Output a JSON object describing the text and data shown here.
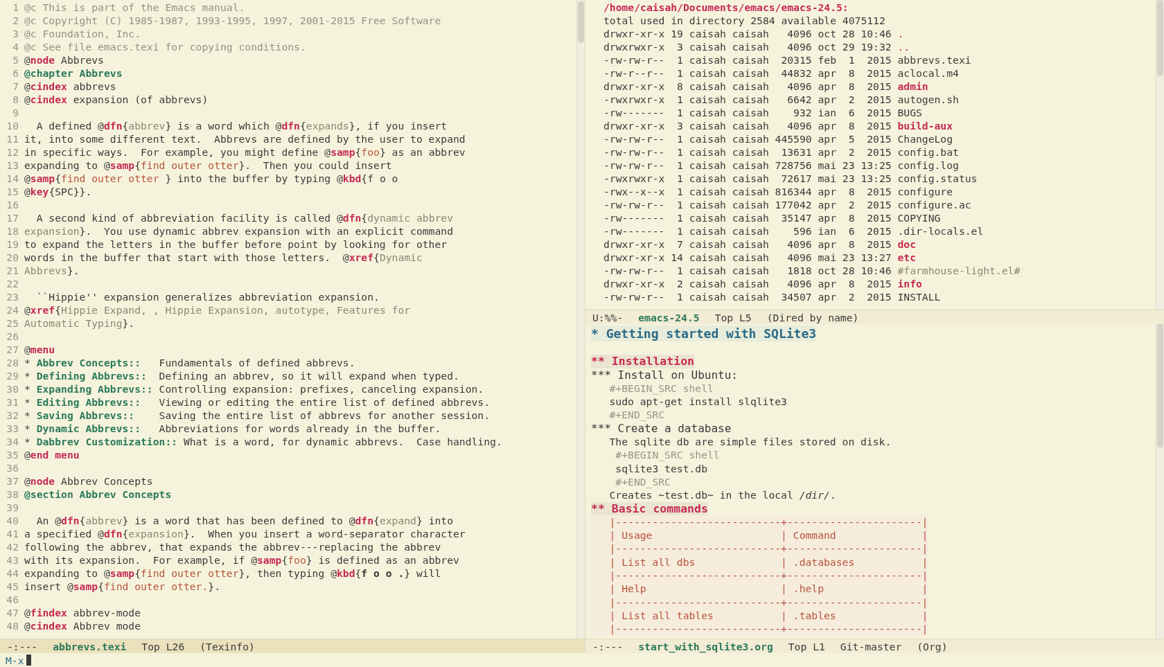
{
  "texinfo_window": {
    "lines": [
      {
        "num": "1",
        "segs": [
          {
            "kind": "c",
            "text": "@c This is part of the Emacs manual."
          }
        ]
      },
      {
        "num": "2",
        "segs": [
          {
            "kind": "c",
            "text": "@c Copyright (C) 1985-1987, 1993-1995, 1997, 2001-2015 Free Software"
          }
        ]
      },
      {
        "num": "3",
        "segs": [
          {
            "kind": "c",
            "text": "@c Foundation, Inc."
          }
        ]
      },
      {
        "num": "4",
        "segs": [
          {
            "kind": "c",
            "text": "@c See file emacs.texi for copying conditions."
          }
        ]
      },
      {
        "num": "5",
        "segs": [
          {
            "kind": "p",
            "text": "@"
          },
          {
            "kind": "k",
            "text": "node"
          },
          {
            "kind": "p",
            "text": " Abbrevs"
          }
        ]
      },
      {
        "num": "6",
        "segs": [
          {
            "kind": "h",
            "text": "@chapter Abbrevs"
          }
        ]
      },
      {
        "num": "7",
        "segs": [
          {
            "kind": "p",
            "text": "@"
          },
          {
            "kind": "k",
            "text": "cindex"
          },
          {
            "kind": "p",
            "text": " abbrevs"
          }
        ]
      },
      {
        "num": "8",
        "segs": [
          {
            "kind": "p",
            "text": "@"
          },
          {
            "kind": "k",
            "text": "cindex"
          },
          {
            "kind": "p",
            "text": " expansion (of abbrevs)"
          }
        ]
      },
      {
        "num": "9"
      },
      {
        "num": "10",
        "segs": [
          {
            "kind": "p",
            "text": "  A defined @"
          },
          {
            "kind": "k",
            "text": "dfn"
          },
          {
            "kind": "p",
            "text": "{"
          },
          {
            "kind": "a",
            "text": "abbrev"
          },
          {
            "kind": "p",
            "text": "} is a word which @"
          },
          {
            "kind": "k",
            "text": "dfn"
          },
          {
            "kind": "p",
            "text": "{"
          },
          {
            "kind": "a",
            "text": "expands"
          },
          {
            "kind": "p",
            "text": "}, if you insert"
          }
        ]
      },
      {
        "num": "11",
        "segs": [
          {
            "kind": "p",
            "text": "it, into some different text.  Abbrevs are defined by the user to expand"
          }
        ]
      },
      {
        "num": "12",
        "segs": [
          {
            "kind": "p",
            "text": "in specific ways.  For example, you might define @"
          },
          {
            "kind": "k",
            "text": "samp"
          },
          {
            "kind": "p",
            "text": "{"
          },
          {
            "kind": "s",
            "text": "foo"
          },
          {
            "kind": "p",
            "text": "} as an abbrev"
          }
        ]
      },
      {
        "num": "13",
        "segs": [
          {
            "kind": "p",
            "text": "expanding to @"
          },
          {
            "kind": "k",
            "text": "samp"
          },
          {
            "kind": "p",
            "text": "{"
          },
          {
            "kind": "s",
            "text": "find outer otter"
          },
          {
            "kind": "p",
            "text": "}.  Then you could insert"
          }
        ]
      },
      {
        "num": "14",
        "segs": [
          {
            "kind": "p",
            "text": "@"
          },
          {
            "kind": "k",
            "text": "samp"
          },
          {
            "kind": "p",
            "text": "{"
          },
          {
            "kind": "s",
            "text": "find outer otter "
          },
          {
            "kind": "p",
            "text": "} into the buffer by typing @"
          },
          {
            "kind": "k",
            "text": "kbd"
          },
          {
            "kind": "p",
            "text": "{f o o"
          }
        ]
      },
      {
        "num": "15",
        "segs": [
          {
            "kind": "p",
            "text": "@"
          },
          {
            "kind": "k",
            "text": "key"
          },
          {
            "kind": "p",
            "text": "{SPC}}."
          }
        ]
      },
      {
        "num": "16"
      },
      {
        "num": "17",
        "segs": [
          {
            "kind": "p",
            "text": "  A second kind of abbreviation facility is called @"
          },
          {
            "kind": "k",
            "text": "dfn"
          },
          {
            "kind": "p",
            "text": "{"
          },
          {
            "kind": "a",
            "text": "dynamic abbrev"
          }
        ]
      },
      {
        "num": "18",
        "segs": [
          {
            "kind": "a",
            "text": "expansion"
          },
          {
            "kind": "p",
            "text": "}.  You use dynamic abbrev expansion with an explicit command"
          }
        ]
      },
      {
        "num": "19",
        "segs": [
          {
            "kind": "p",
            "text": "to expand the letters in the buffer before point by looking for other"
          }
        ]
      },
      {
        "num": "20",
        "segs": [
          {
            "kind": "p",
            "text": "words in the buffer that start with those letters.  @"
          },
          {
            "kind": "k",
            "text": "xref"
          },
          {
            "kind": "p",
            "text": "{"
          },
          {
            "kind": "a",
            "text": "Dynamic"
          }
        ]
      },
      {
        "num": "21",
        "segs": [
          {
            "kind": "a",
            "text": "Abbrevs"
          },
          {
            "kind": "p",
            "text": "}."
          }
        ]
      },
      {
        "num": "22"
      },
      {
        "num": "23",
        "segs": [
          {
            "kind": "p",
            "text": "  ``Hippie'' expansion generalizes abbreviation expansion."
          }
        ]
      },
      {
        "num": "24",
        "segs": [
          {
            "kind": "p",
            "text": "@"
          },
          {
            "kind": "k",
            "text": "xref"
          },
          {
            "kind": "p",
            "text": "{"
          },
          {
            "kind": "a",
            "text": "Hippie Expand, , Hippie Expansion, autotype, Features for"
          }
        ]
      },
      {
        "num": "25",
        "segs": [
          {
            "kind": "a",
            "text": "Automatic Typing"
          },
          {
            "kind": "p",
            "text": "}."
          }
        ]
      },
      {
        "num": "26"
      },
      {
        "num": "27",
        "segs": [
          {
            "kind": "p",
            "text": "@"
          },
          {
            "kind": "k",
            "text": "menu"
          }
        ]
      },
      {
        "num": "28",
        "segs": [
          {
            "kind": "p",
            "text": "* "
          },
          {
            "kind": "h",
            "text": "Abbrev Concepts::"
          },
          {
            "kind": "p",
            "text": "   Fundamentals of defined abbrevs."
          }
        ]
      },
      {
        "num": "29",
        "segs": [
          {
            "kind": "p",
            "text": "* "
          },
          {
            "kind": "h",
            "text": "Defining Abbrevs::"
          },
          {
            "kind": "p",
            "text": "  Defining an abbrev, so it will expand when typed."
          }
        ]
      },
      {
        "num": "30",
        "segs": [
          {
            "kind": "p",
            "text": "* "
          },
          {
            "kind": "h",
            "text": "Expanding Abbrevs::"
          },
          {
            "kind": "p",
            "text": " Controlling expansion: prefixes, canceling expansion."
          }
        ]
      },
      {
        "num": "31",
        "segs": [
          {
            "kind": "p",
            "text": "* "
          },
          {
            "kind": "h",
            "text": "Editing Abbrevs::"
          },
          {
            "kind": "p",
            "text": "   Viewing or editing the entire list of defined abbrevs."
          }
        ]
      },
      {
        "num": "32",
        "segs": [
          {
            "kind": "p",
            "text": "* "
          },
          {
            "kind": "h",
            "text": "Saving Abbrevs::"
          },
          {
            "kind": "p",
            "text": "    Saving the entire list of abbrevs for another session."
          }
        ]
      },
      {
        "num": "33",
        "segs": [
          {
            "kind": "p",
            "text": "* "
          },
          {
            "kind": "h",
            "text": "Dynamic Abbrevs::"
          },
          {
            "kind": "p",
            "text": "   Abbreviations for words already in the buffer."
          }
        ]
      },
      {
        "num": "34",
        "segs": [
          {
            "kind": "p",
            "text": "* "
          },
          {
            "kind": "h",
            "text": "Dabbrev Customization::"
          },
          {
            "kind": "p",
            "text": " What is a word, for dynamic abbrevs.  Case handling."
          }
        ]
      },
      {
        "num": "35",
        "segs": [
          {
            "kind": "p",
            "text": "@"
          },
          {
            "kind": "k",
            "text": "end menu"
          }
        ]
      },
      {
        "num": "36"
      },
      {
        "num": "37",
        "segs": [
          {
            "kind": "p",
            "text": "@"
          },
          {
            "kind": "k",
            "text": "node"
          },
          {
            "kind": "p",
            "text": " Abbrev Concepts"
          }
        ]
      },
      {
        "num": "38",
        "segs": [
          {
            "kind": "h",
            "text": "@section Abbrev Concepts"
          }
        ]
      },
      {
        "num": "39"
      },
      {
        "num": "40",
        "segs": [
          {
            "kind": "p",
            "text": "  An @"
          },
          {
            "kind": "k",
            "text": "dfn"
          },
          {
            "kind": "p",
            "text": "{"
          },
          {
            "kind": "a",
            "text": "abbrev"
          },
          {
            "kind": "p",
            "text": "} is a word that has been defined to @"
          },
          {
            "kind": "k",
            "text": "dfn"
          },
          {
            "kind": "p",
            "text": "{"
          },
          {
            "kind": "a",
            "text": "expand"
          },
          {
            "kind": "p",
            "text": "} into"
          }
        ]
      },
      {
        "num": "41",
        "segs": [
          {
            "kind": "p",
            "text": "a specified @"
          },
          {
            "kind": "k",
            "text": "dfn"
          },
          {
            "kind": "p",
            "text": "{"
          },
          {
            "kind": "a",
            "text": "expansion"
          },
          {
            "kind": "p",
            "text": "}.  When you insert a word-separator character"
          }
        ]
      },
      {
        "num": "42",
        "segs": [
          {
            "kind": "p",
            "text": "following the abbrev, that expands the abbrev---replacing the abbrev"
          }
        ]
      },
      {
        "num": "43",
        "segs": [
          {
            "kind": "p",
            "text": "with its expansion.  For example, if @"
          },
          {
            "kind": "k",
            "text": "samp"
          },
          {
            "kind": "p",
            "text": "{"
          },
          {
            "kind": "s",
            "text": "foo"
          },
          {
            "kind": "p",
            "text": "} is defined as an abbrev"
          }
        ]
      },
      {
        "num": "44",
        "segs": [
          {
            "kind": "p",
            "text": "expanding to @"
          },
          {
            "kind": "k",
            "text": "samp"
          },
          {
            "kind": "p",
            "text": "{"
          },
          {
            "kind": "s",
            "text": "find outer otter"
          },
          {
            "kind": "p",
            "text": "}, then typing @"
          },
          {
            "kind": "k",
            "text": "kbd"
          },
          {
            "kind": "p",
            "text": "{"
          },
          {
            "kind": "b",
            "text": "f o o ."
          },
          {
            "kind": "p",
            "text": "} will"
          }
        ]
      },
      {
        "num": "45",
        "segs": [
          {
            "kind": "p",
            "text": "insert @"
          },
          {
            "kind": "k",
            "text": "samp"
          },
          {
            "kind": "p",
            "text": "{"
          },
          {
            "kind": "s",
            "text": "find outer otter."
          },
          {
            "kind": "p",
            "text": "}."
          }
        ]
      },
      {
        "num": "46"
      },
      {
        "num": "47",
        "segs": [
          {
            "kind": "p",
            "text": "@"
          },
          {
            "kind": "k",
            "text": "findex"
          },
          {
            "kind": "p",
            "text": " abbrev-mode"
          }
        ]
      },
      {
        "num": "48",
        "segs": [
          {
            "kind": "p",
            "text": "@"
          },
          {
            "kind": "k",
            "text": "cindex"
          },
          {
            "kind": "p",
            "text": " Abbrev mode"
          }
        ]
      }
    ],
    "mode_line": {
      "active": true,
      "state": "-:---",
      "buffer": "abbrevs.texi",
      "position": "Top L26",
      "mode": "(Texinfo)"
    }
  },
  "dired_window": {
    "header": "/home/caisah/Documents/emacs/emacs-24.5:",
    "total": "total used in directory 2584 available 4075112",
    "rows": [
      {
        "info": "drwxr-xr-x 19 caisah caisah   4096 oct 28 10:46",
        "name": ".",
        "kind": "dot"
      },
      {
        "info": "drwxrwxr-x  3 caisah caisah   4096 oct 29 19:32",
        "name": "..",
        "kind": "dot"
      },
      {
        "info": "-rw-rw-r--  1 caisah caisah  20315 feb  1  2015",
        "name": "abbrevs.texi",
        "kind": "file"
      },
      {
        "info": "-rw-r--r--  1 caisah caisah  44832 apr  8  2015",
        "name": "aclocal.m4",
        "kind": "file"
      },
      {
        "info": "drwxr-xr-x  8 caisah caisah   4096 apr  8  2015",
        "name": "admin",
        "kind": "dir"
      },
      {
        "info": "-rwxrwxr-x  1 caisah caisah   6642 apr  2  2015",
        "name": "autogen.sh",
        "kind": "file"
      },
      {
        "info": "-rw-------  1 caisah caisah    932 ian  6  2015",
        "name": "BUGS",
        "kind": "file"
      },
      {
        "info": "drwxr-xr-x  3 caisah caisah   4096 apr  8  2015",
        "name": "build-aux",
        "kind": "dir"
      },
      {
        "info": "-rw-rw-r--  1 caisah caisah 445590 apr  5  2015",
        "name": "ChangeLog",
        "kind": "file"
      },
      {
        "info": "-rw-rw-r--  1 caisah caisah  13631 apr  2  2015",
        "name": "config.bat",
        "kind": "file"
      },
      {
        "info": "-rw-rw-r--  1 caisah caisah 728756 mai 23 13:25",
        "name": "config.log",
        "kind": "file"
      },
      {
        "info": "-rwxrwxr-x  1 caisah caisah  72617 mai 23 13:25",
        "name": "config.status",
        "kind": "file"
      },
      {
        "info": "-rwx--x--x  1 caisah caisah 816344 apr  8  2015",
        "name": "configure",
        "kind": "file"
      },
      {
        "info": "-rw-rw-r--  1 caisah caisah 177042 apr  2  2015",
        "name": "configure.ac",
        "kind": "file"
      },
      {
        "info": "-rw-------  1 caisah caisah  35147 apr  8  2015",
        "name": "COPYING",
        "kind": "file"
      },
      {
        "info": "-rw-------  1 caisah caisah    596 ian  6  2015",
        "name": ".dir-locals.el",
        "kind": "file"
      },
      {
        "info": "drwxr-xr-x  7 caisah caisah   4096 apr  8  2015",
        "name": "doc",
        "kind": "dir"
      },
      {
        "info": "drwxr-xr-x 14 caisah caisah   4096 mai 23 13:27",
        "name": "etc",
        "kind": "dir"
      },
      {
        "info": "-rw-rw-r--  1 caisah caisah   1818 oct 28 10:46",
        "name": "#farmhouse-light.el#",
        "kind": "backup"
      },
      {
        "info": "drwxr-xr-x  2 caisah caisah   4096 apr  8  2015",
        "name": "info",
        "kind": "dir"
      },
      {
        "info": "-rw-rw-r--  1 caisah caisah  34507 apr  2  2015",
        "name": "INSTALL",
        "kind": "file"
      }
    ],
    "mode_line": {
      "active": false,
      "state": "U:%%-",
      "buffer": "emacs-24.5",
      "position": "Top L5",
      "mode": "(Dired by name)"
    }
  },
  "org_window": {
    "lines": [
      {
        "kind": "h1",
        "text": "* Getting started with SQLite3"
      },
      {
        "kind": "blank"
      },
      {
        "kind": "h2",
        "text": "** Installation"
      },
      {
        "kind": "h3",
        "text": "*** Install on Ubuntu:"
      },
      {
        "kind": "meta",
        "text": "   #+BEGIN_SRC shell"
      },
      {
        "kind": "text",
        "text": "   sudo apt-get install slqlite3"
      },
      {
        "kind": "meta",
        "text": "   #+END_SRC"
      },
      {
        "kind": "h3",
        "text": "*** Create a database"
      },
      {
        "kind": "text",
        "text": "   The sqlite db are simple files stored on disk."
      },
      {
        "kind": "meta",
        "text": "    #+BEGIN_SRC shell"
      },
      {
        "kind": "text",
        "text": "    sqlite3 test.db"
      },
      {
        "kind": "meta",
        "text": "    #+END_SRC"
      },
      {
        "kind": "text",
        "text": "   Creates ~test.db~ in the local */dir/*."
      },
      {
        "kind": "h2",
        "text": "** Basic commands"
      },
      {
        "kind": "table",
        "text": "   |---------------------------+----------------------|"
      },
      {
        "kind": "table",
        "text": "   | Usage                     | Command              |"
      },
      {
        "kind": "table",
        "text": "   |---------------------------+----------------------|"
      },
      {
        "kind": "table",
        "text": "   | List all dbs              | .databases           |"
      },
      {
        "kind": "table",
        "text": "   |---------------------------+----------------------|"
      },
      {
        "kind": "table",
        "text": "   | Help                      | .help                |"
      },
      {
        "kind": "table",
        "text": "   |---------------------------+----------------------|"
      },
      {
        "kind": "table",
        "text": "   | List all tables           | .tables              |"
      },
      {
        "kind": "table",
        "text": "   |---------------------------+----------------------|"
      }
    ],
    "mode_line": {
      "active": false,
      "state": "-:---",
      "buffer": "start_with_sqlite3.org",
      "position": "Top L1",
      "vc": "Git-master",
      "mode": "(Org)"
    }
  },
  "minibuffer": {
    "prompt": "M-x"
  }
}
